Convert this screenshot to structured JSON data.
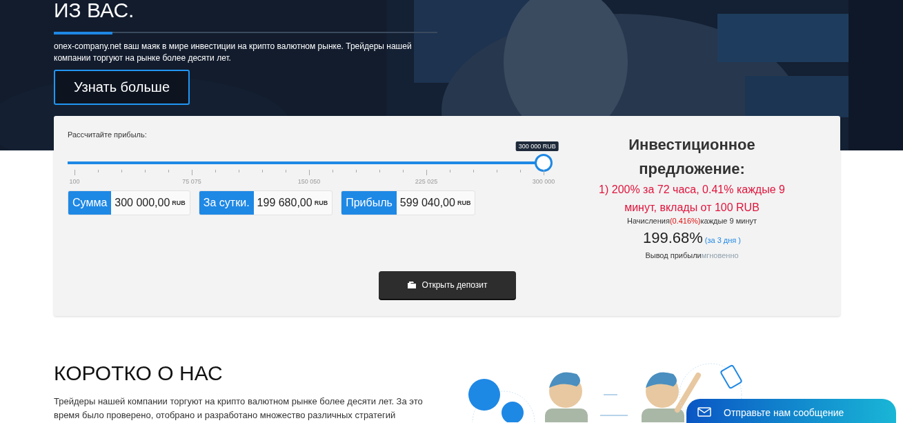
{
  "hero": {
    "title": "ИЗ ВАС.",
    "text": "onex-company.net ваш маяк в мире инвестиции на крипто валютном рынке. Трейдеры нашей компании торгуют на рынке более десяти лет.",
    "button": "Узнать больше"
  },
  "calculator": {
    "label": "Рассчитайте прибыль:",
    "slider": {
      "level": 1,
      "tooltip": "300 000 RUB",
      "ticks": [
        "100",
        "75 075",
        "150 050",
        "225 025",
        "300 000"
      ]
    },
    "results": [
      {
        "label": "Сумма",
        "value": "300 000,00",
        "unit": "RUB"
      },
      {
        "label": "За сутки.",
        "value": "199 680,00",
        "unit": "RUB"
      },
      {
        "label": "Прибыль",
        "value": "599 040,00",
        "unit": "RUB"
      }
    ],
    "offer": {
      "title": "Инвестиционное предложение:",
      "plan": "1) 200% за 72 часа, 0.41% каждые 9 минут, вклады от 100 RUB",
      "accrual_label": "Начисления",
      "accrual_rate": "(0.416%)",
      "accrual_period": "каждые 9 минут",
      "total": "199.68%",
      "total_period": "(за 3 дня )",
      "withdraw_label": "Вывод прибыли",
      "withdraw_value": "мгновенно"
    },
    "button": "Открыть депозит"
  },
  "about": {
    "title": "КОРОТКО О НАС",
    "text": "Трейдеры нашей компании торгуют на крипто валютном рынке более десяти лет. За это время было проверено, отобрано и разработано множество различных стратегий"
  },
  "chat": {
    "label": "Отправьте нам сообщение"
  }
}
